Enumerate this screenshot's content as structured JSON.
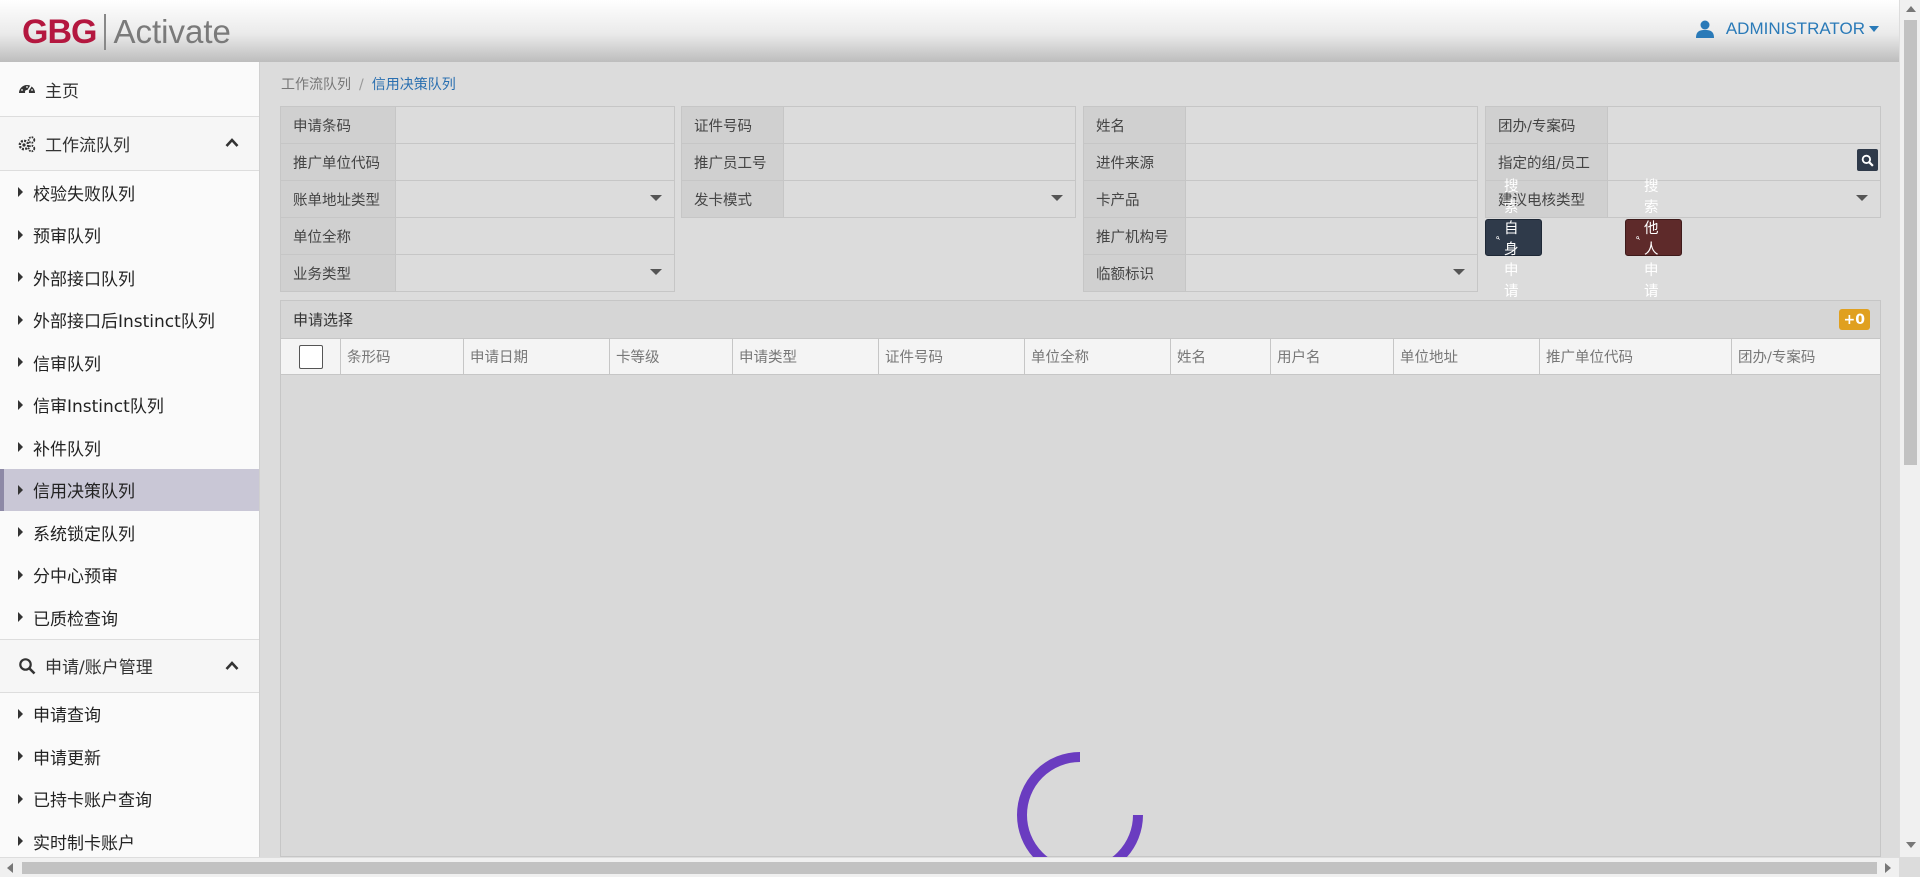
{
  "header": {
    "logo_brand": "GBG",
    "logo_product": "Activate",
    "user_name": "ADMINISTRATOR"
  },
  "sidebar": {
    "home": "主页",
    "group_workflow": "工作流队列",
    "workflow_items": [
      {
        "label": "校验失败队列"
      },
      {
        "label": "预审队列"
      },
      {
        "label": "外部接口队列"
      },
      {
        "label": "外部接口后Instinct队列"
      },
      {
        "label": "信审队列"
      },
      {
        "label": "信审Instinct队列"
      },
      {
        "label": "补件队列"
      },
      {
        "label": "信用决策队列",
        "active": true
      },
      {
        "label": "系统锁定队列"
      },
      {
        "label": "分中心预审"
      },
      {
        "label": "已质检查询"
      }
    ],
    "group_account": "申请/账户管理",
    "account_items": [
      {
        "label": "申请查询"
      },
      {
        "label": "申请更新"
      },
      {
        "label": "已持卡账户查询"
      },
      {
        "label": "实时制卡账户"
      }
    ]
  },
  "breadcrumb": {
    "parent": "工作流队列",
    "current": "信用决策队列"
  },
  "form": {
    "col1": [
      "申请条码",
      "推广单位代码",
      "账单地址类型",
      "单位全称",
      "业务类型"
    ],
    "col2": [
      "证件号码",
      "推广员工号",
      "发卡模式"
    ],
    "col3": [
      "姓名",
      "进件来源",
      "卡产品",
      "推广机构号",
      "临额标识"
    ],
    "col4": [
      "团办/专案码",
      "指定的组/员工",
      "建议电核类型"
    ],
    "btn_search_self": "搜索自身申请",
    "btn_search_others": "搜索他人申请"
  },
  "panel": {
    "title": "申请选择",
    "badge": "+0",
    "columns": [
      "条形码",
      "申请日期",
      "卡等级",
      "申请类型",
      "证件号码",
      "单位全称",
      "姓名",
      "用户名",
      "单位地址",
      "推广单位代码",
      "团办/专案码"
    ]
  },
  "colors": {
    "brand_red": "#b4173f",
    "link_blue": "#2a6fb0",
    "spinner_purple": "#6a3cc0",
    "badge_orange": "#e0a020",
    "btn_dark": "#2f3a4a",
    "btn_maroon": "#5e2a2a"
  }
}
